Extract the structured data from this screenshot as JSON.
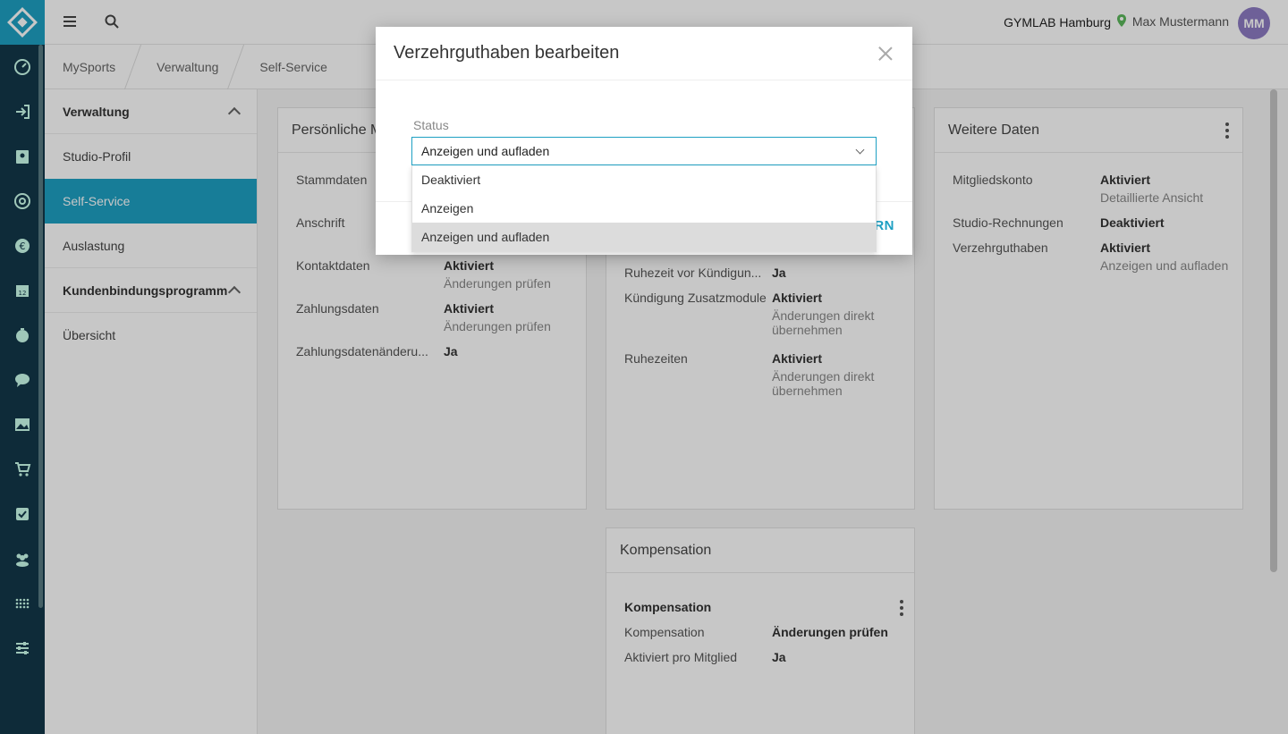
{
  "topbar": {
    "studio": "GYMLAB Hamburg",
    "user": "Max Mustermann",
    "avatar": "MM"
  },
  "breadcrumb": [
    "MySports",
    "Verwaltung",
    "Self-Service"
  ],
  "subnav": {
    "section1": "Verwaltung",
    "items1": [
      "Studio-Profil",
      "Self-Service",
      "Auslastung"
    ],
    "section2": "Kundenbindungsprogramm",
    "items2": [
      "Übersicht"
    ]
  },
  "card1": {
    "title": "Persönliche Mi",
    "rows": [
      {
        "k": "Stammdaten"
      },
      {
        "k": "Anschrift"
      },
      {
        "k": "Kontaktdaten",
        "v": "Aktiviert",
        "sub": "Änderungen prüfen"
      },
      {
        "k": "Zahlungsdaten",
        "v": "Aktiviert",
        "sub": "Änderungen prüfen"
      },
      {
        "k": "Zahlungsdatenänderu...",
        "v": "Ja"
      }
    ]
  },
  "card2": {
    "rows": [
      {
        "k": "Ruhezeit vor Kündigun...",
        "v": "Ja"
      },
      {
        "k": "Kündigung Zusatzmodule",
        "v": "Aktiviert",
        "sub": "Änderungen direkt übernehmen"
      },
      {
        "k": "Ruhezeiten",
        "v": "Aktiviert",
        "sub": "Änderungen direkt übernehmen"
      }
    ]
  },
  "card3": {
    "title": "Weitere Daten",
    "rows": [
      {
        "k": "Mitgliedskonto",
        "v": "Aktiviert",
        "sub": "Detaillierte Ansicht"
      },
      {
        "k": "Studio-Rechnungen",
        "v": "Deaktiviert"
      },
      {
        "k": "Verzehrguthaben",
        "v": "Aktiviert",
        "sub": "Anzeigen und aufladen"
      }
    ]
  },
  "card4": {
    "title": "Kompensation",
    "section": "Kompensation",
    "rows": [
      {
        "k": "Kompensation",
        "v": "Änderungen prüfen"
      },
      {
        "k": "Aktiviert pro Mitglied",
        "v": "Ja"
      }
    ]
  },
  "modal": {
    "title": "Verzehrguthaben bearbeiten",
    "label": "Status",
    "selected": "Anzeigen und aufladen",
    "options": [
      "Deaktiviert",
      "Anzeigen",
      "Anzeigen und aufladen"
    ],
    "save_partial": "RN"
  },
  "colors": {
    "accent": "#1ea0c3",
    "rail": "#13384a",
    "avatar": "#8d7bc3"
  }
}
